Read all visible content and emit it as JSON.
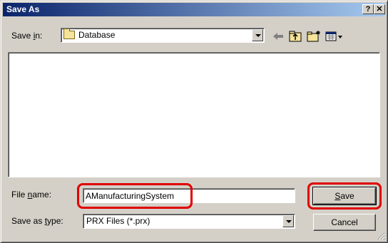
{
  "window": {
    "title": "Save As",
    "help": "?",
    "close": "✕"
  },
  "save_in": {
    "label_pre": "Save ",
    "label_mnemonic": "i",
    "label_post": "n:",
    "value": "Database"
  },
  "toolbar": {
    "icons": [
      "back-arrow-icon",
      "up-folder-icon",
      "new-folder-icon",
      "view-menu-icon"
    ]
  },
  "file_name": {
    "label_pre": "File ",
    "label_mnemonic": "n",
    "label_post": "ame:",
    "value": "AManufacturingSystem"
  },
  "save_as_type": {
    "label_pre": "Save as ",
    "label_mnemonic": "t",
    "label_post": "ype:",
    "value": "PRX Files (*.prx)"
  },
  "buttons": {
    "save_mnemonic": "S",
    "save_rest": "ave",
    "cancel": "Cancel"
  },
  "colors": {
    "title_gradient_start": "#0a246a",
    "title_gradient_end": "#a6caf0",
    "highlight": "#e00000",
    "face": "#d4d0c8"
  }
}
